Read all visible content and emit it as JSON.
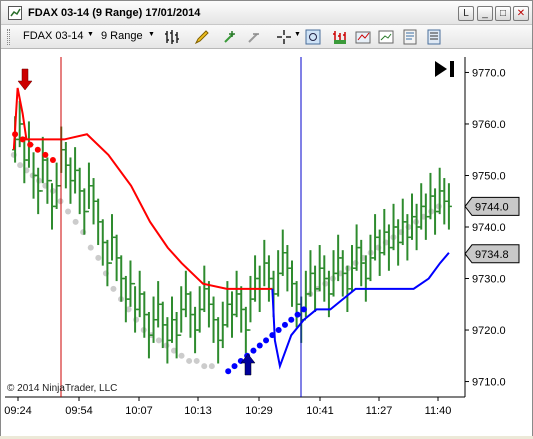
{
  "window": {
    "title": "FDAX 03-14 (9 Range)  17/01/2014",
    "buttons": [
      "L",
      "_",
      "□",
      "✕"
    ]
  },
  "toolbar": {
    "instrument": "FDAX 03-14",
    "interval": "9 Range"
  },
  "chart": {
    "copyright": "© 2014 NinjaTrader, LLC",
    "colors": {
      "up_bar": "#2e8b2e",
      "upper_band": "#ff0000",
      "lower_band": "#0000ff",
      "trail_dots": "#cccccc",
      "signal_down": "#cc0000",
      "signal_up": "#00009c",
      "vline_red": "#cc0000",
      "vline_blue": "#0000cc"
    },
    "icons": [
      "play-to-end-icon",
      "down-arrow-signal-icon",
      "up-arrow-signal-icon"
    ]
  },
  "chart_data": {
    "type": "line",
    "x_tick_labels": [
      "09:24",
      "09:54",
      "10:07",
      "10:13",
      "10:29",
      "10:41",
      "11:27",
      "11:40"
    ],
    "y_ticks": [
      9710.0,
      9720.0,
      9730.0,
      9740.0,
      9750.0,
      9760.0,
      9770.0
    ],
    "y_tick_labels": [
      "9710.0",
      "9720.0",
      "9730.0",
      "9740.0",
      "9750.0",
      "9760.0",
      "9770.0"
    ],
    "ylim": [
      9707,
      9773
    ],
    "price_markers": [
      {
        "label": "9744.0",
        "value": 9744.0
      },
      {
        "label": "9734.8",
        "value": 9734.8
      }
    ],
    "bars_close": [
      9757,
      9760,
      9753,
      9756,
      9750,
      9747,
      9753,
      9749,
      9744,
      9748,
      9755,
      9752,
      9749,
      9751,
      9747,
      9743,
      9748,
      9745,
      9741,
      9737,
      9733,
      9738,
      9734,
      9730,
      9726,
      9729,
      9724,
      9727,
      9723,
      9719,
      9722,
      9725,
      9721,
      9718,
      9722,
      9719,
      9724,
      9727,
      9723,
      9720,
      9724,
      9728,
      9725,
      9722,
      9718,
      9721,
      9725,
      9723,
      9727,
      9724,
      9720,
      9726,
      9730,
      9728,
      9733,
      9730,
      9727,
      9731,
      9735,
      9732,
      9729,
      9725,
      9722,
      9727,
      9731,
      9728,
      9732,
      9730,
      9727,
      9731,
      9734,
      9731,
      9728,
      9732,
      9736,
      9733,
      9730,
      9734,
      9738,
      9735,
      9739,
      9736,
      9740,
      9737,
      9741,
      9738,
      9742,
      9740,
      9744,
      9742,
      9746,
      9743,
      9747,
      9745,
      9744
    ],
    "upper_band": [
      [
        9755,
        9755
      ],
      [
        9758,
        9767
      ],
      [
        9762,
        9762
      ],
      [
        9765,
        9757
      ],
      [
        9770,
        9757
      ],
      [
        9795,
        9757
      ],
      [
        9813,
        9758
      ],
      [
        9830,
        9754
      ],
      [
        9848,
        9748
      ],
      [
        9863,
        9741
      ],
      [
        9877,
        9736
      ],
      [
        9888,
        9733
      ],
      [
        9905,
        9729
      ],
      [
        9924,
        9728
      ],
      [
        9942,
        9728
      ],
      [
        9960,
        9728
      ]
    ],
    "lower_band": [
      [
        9960,
        9728
      ],
      [
        9962,
        9718
      ],
      [
        9966,
        9713
      ],
      [
        9975,
        9719
      ],
      [
        9985,
        9722
      ],
      [
        9995,
        9724
      ],
      [
        10006,
        9724
      ],
      [
        10016,
        9726
      ],
      [
        10026,
        9728
      ],
      [
        10040,
        9728
      ],
      [
        10056,
        9728
      ],
      [
        10072,
        9728
      ],
      [
        10084,
        9730
      ],
      [
        10093,
        9733
      ],
      [
        10100,
        9735
      ]
    ],
    "trail_dots": [
      [
        9755,
        9754
      ],
      [
        9760,
        9752
      ],
      [
        9765,
        9751
      ],
      [
        9770,
        9750
      ],
      [
        9775,
        9749
      ],
      [
        9780,
        9748
      ],
      [
        9786,
        9747
      ],
      [
        9792,
        9745
      ],
      [
        9798,
        9743
      ],
      [
        9804,
        9741
      ],
      [
        9810,
        9739
      ],
      [
        9816,
        9736
      ],
      [
        9822,
        9734
      ],
      [
        9828,
        9731
      ],
      [
        9834,
        9728
      ],
      [
        9840,
        9726
      ],
      [
        9846,
        9724
      ],
      [
        9852,
        9722
      ],
      [
        9858,
        9720
      ],
      [
        9864,
        9719
      ],
      [
        9870,
        9718
      ],
      [
        9876,
        9717
      ],
      [
        9882,
        9716
      ],
      [
        9888,
        9715
      ],
      [
        9894,
        9714
      ],
      [
        9900,
        9714
      ],
      [
        9906,
        9713
      ],
      [
        9912,
        9713
      ],
      [
        9990,
        9727
      ],
      [
        9996,
        9728
      ],
      [
        10002,
        9729
      ],
      [
        10008,
        9730
      ],
      [
        10014,
        9731
      ],
      [
        10020,
        9732
      ],
      [
        10026,
        9733
      ],
      [
        10032,
        9734
      ],
      [
        10038,
        9735
      ],
      [
        10044,
        9736
      ],
      [
        10050,
        9737
      ],
      [
        10056,
        9738
      ],
      [
        10062,
        9739
      ],
      [
        10068,
        9740
      ],
      [
        10074,
        9741
      ],
      [
        10080,
        9742
      ],
      [
        10086,
        9743
      ],
      [
        10092,
        9744
      ]
    ],
    "red_dots": [
      [
        9756,
        9758
      ],
      [
        9762,
        9757
      ],
      [
        9768,
        9756
      ],
      [
        9774,
        9755
      ],
      [
        9780,
        9754
      ],
      [
        9786,
        9753
      ]
    ],
    "blue_dots": [
      [
        9925,
        9712
      ],
      [
        9930,
        9713
      ],
      [
        9935,
        9714
      ],
      [
        9940,
        9715
      ],
      [
        9945,
        9716
      ],
      [
        9950,
        9717
      ],
      [
        9955,
        9718
      ],
      [
        9960,
        9719
      ],
      [
        9965,
        9720
      ],
      [
        9970,
        9721
      ],
      [
        9975,
        9722
      ],
      [
        9980,
        9723
      ],
      [
        9985,
        9724
      ]
    ],
    "x_unit_note": "",
    "grid": false,
    "legend": "none"
  }
}
